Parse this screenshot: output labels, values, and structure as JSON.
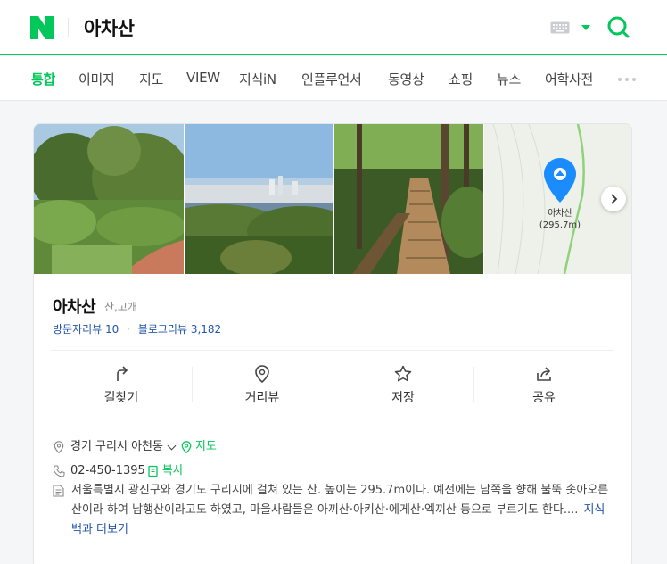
{
  "header": {
    "query": "아차산"
  },
  "tabs": [
    {
      "label": "통합",
      "active": true
    },
    {
      "label": "이미지"
    },
    {
      "label": "지도"
    },
    {
      "label": "VIEW"
    },
    {
      "label": "지식iN"
    },
    {
      "label": "인플루언서"
    },
    {
      "label": "동영상"
    },
    {
      "label": "쇼핑"
    },
    {
      "label": "뉴스"
    },
    {
      "label": "어학사전"
    }
  ],
  "place": {
    "name": "아차산",
    "category": "산,고개",
    "visitor_review_label": "방문자리뷰",
    "visitor_review_count": "10",
    "blog_review_label": "블로그리뷰",
    "blog_review_count": "3,182",
    "map_pin_label": "아차산",
    "map_pin_elevation": "(295.7m)"
  },
  "actions": [
    {
      "label": "길찾기",
      "icon": "directions-icon"
    },
    {
      "label": "거리뷰",
      "icon": "location-pin-icon"
    },
    {
      "label": "저장",
      "icon": "star-icon"
    },
    {
      "label": "공유",
      "icon": "share-icon"
    }
  ],
  "info": {
    "address": "경기 구리시 아천동",
    "map_link": "지도",
    "phone": "02-450-1395",
    "copy_link": "복사",
    "description": "서울특별시 광진구와 경기도 구리시에 걸쳐 있는 산. 높이는 295.7m이다. 예전에는 남쪽을 향해 불뚝 솟아오른 산이라 하여 남행산이라고도 하였고, 마을사람들은 아끼산·아키산·에게산·엑끼산 등으로 부르기도 한다....",
    "more_link": "지식백과 더보기"
  },
  "colors": {
    "brand": "#03c75a",
    "link": "#2155a8",
    "pin": "#1a8cff"
  }
}
